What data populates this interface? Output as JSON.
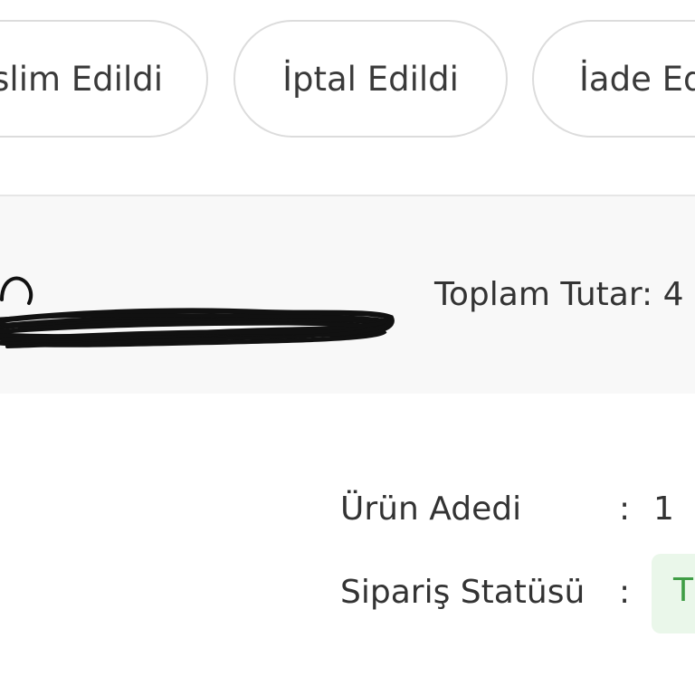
{
  "filters": {
    "chip1_label": "Teslim Edildi",
    "chip2_label": "İptal Edildi",
    "chip3_label": "İade Edildi"
  },
  "order": {
    "total_label": "Toplam Tutar: 4"
  },
  "details": {
    "quantity_label": "Ürün Adedi",
    "quantity_colon": ":",
    "quantity_value": "1",
    "status_label": "Sipariş Statüsü",
    "status_colon": ":",
    "status_value": "T"
  },
  "colors": {
    "status_badge_bg": "#eaf7ea",
    "status_badge_text": "#3f9d45",
    "header_band_bg": "#f8f8f8"
  }
}
